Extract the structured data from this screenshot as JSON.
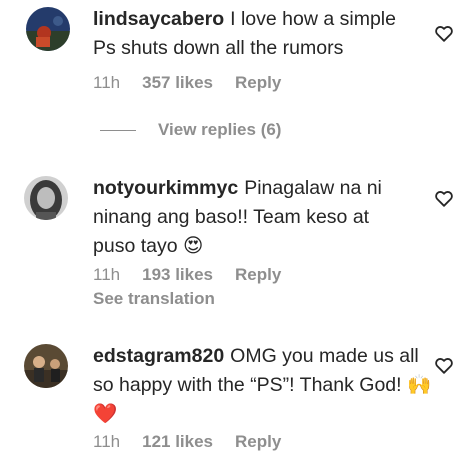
{
  "comments": [
    {
      "username": "lindsaycabero",
      "text": "I love how a simple Ps shuts down all the rumors",
      "time": "11h",
      "likes": "357 likes",
      "reply": "Reply",
      "view_replies": "View replies (6)"
    },
    {
      "username": "notyourkimmyc",
      "text": "Pinagalaw na ni ninang ang baso!! Team keso at puso tayo 😍",
      "time": "11h",
      "likes": "193 likes",
      "reply": "Reply",
      "see_translation": "See translation"
    },
    {
      "username": "edstagram820",
      "text": "OMG you made us all so happy with the “PS”! Thank God! 🙌❤️",
      "time": "11h",
      "likes": "121 likes",
      "reply": "Reply"
    }
  ],
  "icons": {
    "like": "heart-outline-icon"
  }
}
